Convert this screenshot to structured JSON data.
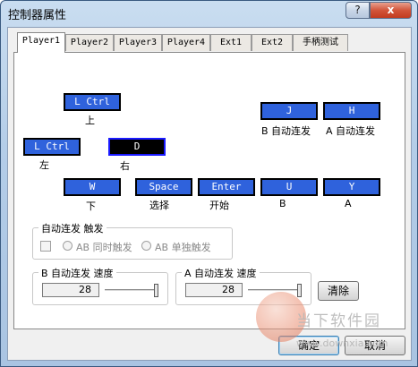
{
  "window": {
    "title": "控制器属性",
    "help_glyph": "?",
    "close_glyph": "x"
  },
  "tabs": [
    {
      "label": "Player1",
      "active": true
    },
    {
      "label": "Player2"
    },
    {
      "label": "Player3"
    },
    {
      "label": "Player4"
    },
    {
      "label": "Ext1"
    },
    {
      "label": "Ext2"
    },
    {
      "label": "手柄测试"
    }
  ],
  "keys": {
    "up": {
      "key": "L Ctrl",
      "label": "上"
    },
    "left": {
      "key": "L Ctrl",
      "label": "左"
    },
    "right": {
      "key": "D",
      "label": "右"
    },
    "down": {
      "key": "W",
      "label": "下"
    },
    "select": {
      "key": "Space",
      "label": "选择"
    },
    "start": {
      "key": "Enter",
      "label": "开始"
    },
    "b": {
      "key": "U",
      "label": "B"
    },
    "a": {
      "key": "Y",
      "label": "A"
    },
    "b_turbo": {
      "key": "J",
      "label": "B 自动连发"
    },
    "a_turbo": {
      "key": "H",
      "label": "A 自动连发"
    }
  },
  "trigger_group": {
    "title": "自动连发 触发",
    "enabled": false,
    "checked": false,
    "option_both": "AB 同时触发",
    "option_single": "AB 单独触发"
  },
  "b_speed": {
    "title": "B 自动连发 速度",
    "value": "28",
    "slider_level": 1.0
  },
  "a_speed": {
    "title": "A 自动连发 速度",
    "value": "28",
    "slider_level": 1.0
  },
  "clear_label": "清除",
  "ok_label": "确定",
  "cancel_label": "取消",
  "watermark": {
    "text": "当下软件园",
    "url": "www.downxia.com"
  }
}
